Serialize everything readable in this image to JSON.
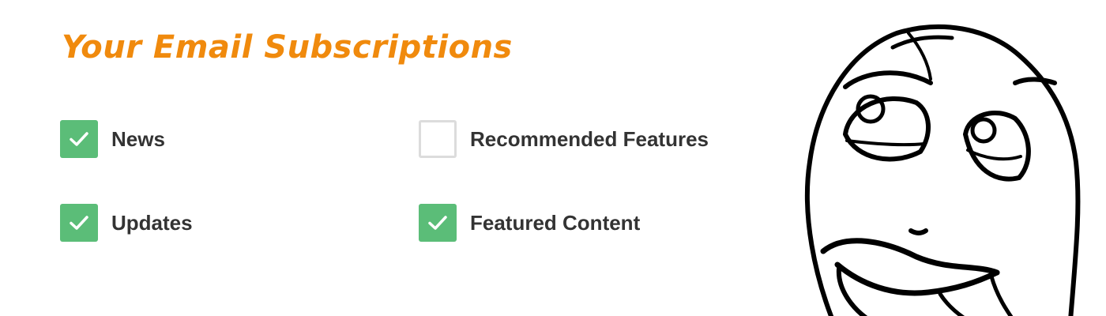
{
  "title": "Your Email Subscriptions",
  "colors": {
    "title": "#f08a0d",
    "checked": "#5bbd78",
    "unchecked_border": "#dcdcdc",
    "label": "#333333"
  },
  "subscriptions": [
    {
      "label": "News",
      "checked": true
    },
    {
      "label": "Recommended Features",
      "checked": false
    },
    {
      "label": "Updates",
      "checked": true
    },
    {
      "label": "Featured Content",
      "checked": true
    }
  ],
  "illustration": {
    "icon": "thinking-face-icon"
  }
}
